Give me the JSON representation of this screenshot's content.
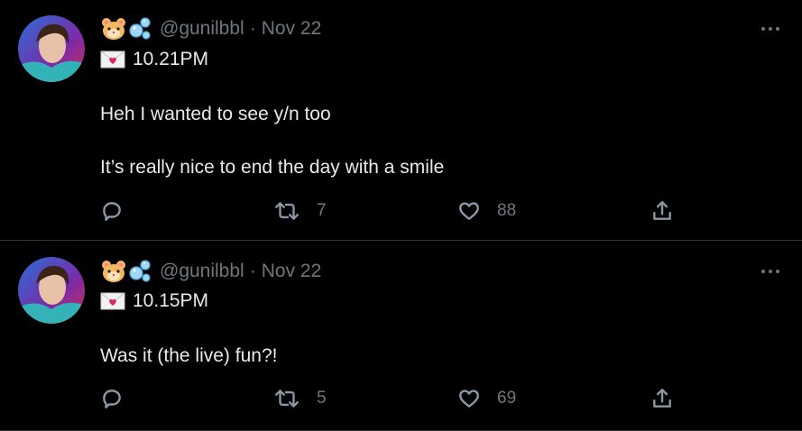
{
  "tweets": [
    {
      "handle": "@gunilbbl",
      "separator": "·",
      "date": "Nov 22",
      "time_line": "10.21PM",
      "text_lines": [
        "Heh I wanted to see y/n too",
        "It’s really nice to end the day with a smile"
      ],
      "actions": {
        "reply": "",
        "retweet": "7",
        "like": "88"
      }
    },
    {
      "handle": "@gunilbbl",
      "separator": "·",
      "date": "Nov 22",
      "time_line": "10.15PM",
      "text_lines": [
        "Was it (the live) fun?!"
      ],
      "actions": {
        "reply": "",
        "retweet": "5",
        "like": "69"
      }
    }
  ],
  "icons": [
    "hamster-emoji",
    "bubbles-emoji",
    "love-letter-emoji",
    "reply-icon",
    "retweet-icon",
    "like-icon",
    "share-icon",
    "more-icon"
  ]
}
